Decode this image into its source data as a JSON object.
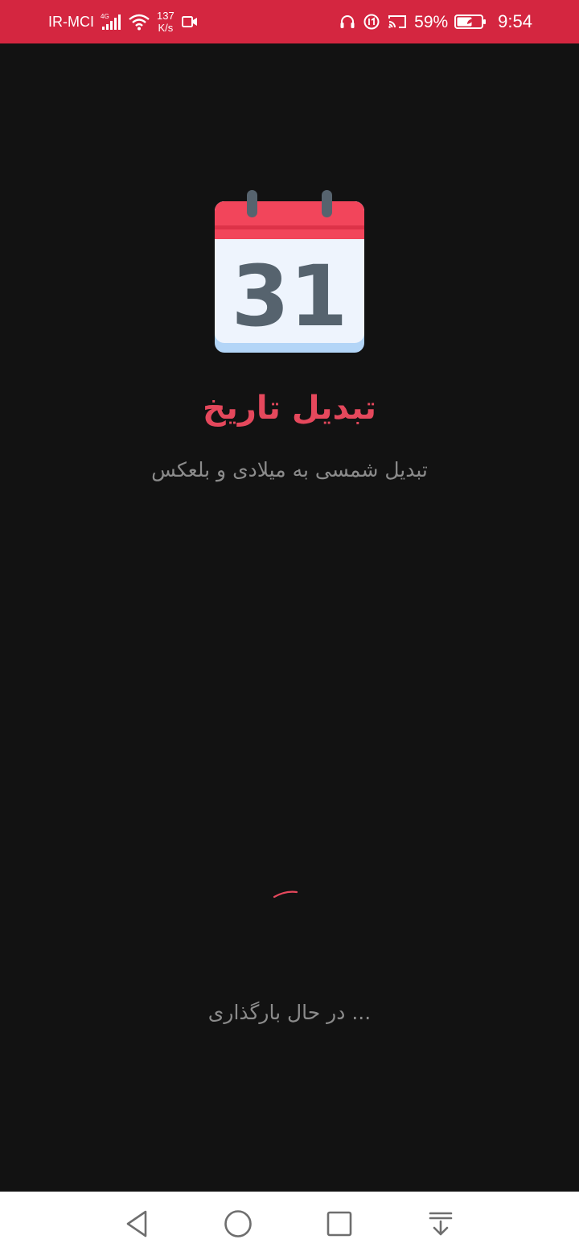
{
  "status_bar": {
    "carrier": "IR-MCI",
    "network_type": "4G",
    "speed_value": "137",
    "speed_unit": "K/s",
    "battery_percent": "59%",
    "time": "9:54",
    "icons": [
      "signal-icon",
      "wifi-icon",
      "video-record-icon",
      "headset-icon",
      "data-saver-icon",
      "cast-icon",
      "battery-icon"
    ]
  },
  "splash": {
    "icon": "calendar-icon",
    "icon_day": "31",
    "title": "تبدیل تاریخ",
    "subtitle": "تبدیل شمسی به میلادی و بلعکس",
    "loading_text": "... در حال بارگذاری"
  },
  "colors": {
    "status_bar_bg": "#D42640",
    "background": "#121212",
    "accent": "#E5485C",
    "secondary_text": "#8B8B8B",
    "calendar_header": "#F2455B",
    "calendar_body": "#EEF4FD",
    "calendar_footer": "#B3D5F7",
    "calendar_digits": "#56636E"
  },
  "nav_bar": {
    "buttons": [
      "back-icon",
      "home-icon",
      "recents-icon",
      "notification-shade-icon"
    ]
  }
}
